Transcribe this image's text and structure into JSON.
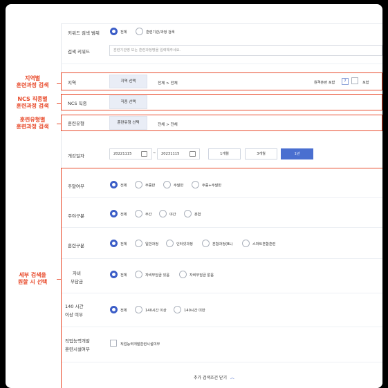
{
  "keyword_scope": {
    "label": "키워드 검색 범위",
    "options": [
      "전체",
      "훈련기관/과정 검색"
    ]
  },
  "keyword": {
    "label": "검색 키워드",
    "placeholder": "훈련기관명 또는 훈련과정명을 입력해주세요."
  },
  "region": {
    "label": "지역",
    "button": "지역 선택",
    "value": "전체 > 전체",
    "nearby_label": "원격훈련 포함",
    "help": "?",
    "include": "포함"
  },
  "ncs": {
    "label": "NCS 직종",
    "button": "직종 선택",
    "value": ""
  },
  "training_type": {
    "label": "훈련유형",
    "button": "훈련유형 선택",
    "value": "전체 > 전체"
  },
  "start_date": {
    "label": "개강일자",
    "from": "20221115",
    "tilde": "~",
    "to": "20231115",
    "periods": [
      "1개월",
      "3개월",
      "1년"
    ],
    "selected_period": "1년"
  },
  "weekend": {
    "label": "주말여부",
    "options": [
      "전체",
      "주중반",
      "주말반",
      "주중+주말반"
    ]
  },
  "daynight": {
    "label": "주야구분",
    "options": [
      "전체",
      "주간",
      "야간",
      "혼합"
    ]
  },
  "training_kind": {
    "label": "훈련구분",
    "options": [
      "전체",
      "일반과정",
      "인터넷과정",
      "혼합과정(BL)",
      "스마트혼합훈련"
    ]
  },
  "self_pay": {
    "label_line1": "자비",
    "label_line2": "부담금",
    "options": [
      "전체",
      "자비부담금 있음",
      "자비부담금 없음"
    ]
  },
  "hours140": {
    "label_line1": "140 시간",
    "label_line2": "이상 여부",
    "options": [
      "전체",
      "140시간 이상",
      "140시간 미만"
    ]
  },
  "facility": {
    "label_line1": "직업능력개발",
    "label_line2": "훈련시설여부",
    "checkbox_label": "직업능력개발훈련시설여부"
  },
  "collapse": {
    "label": "추가 검색조건 닫기"
  },
  "annotations": {
    "region_line1": "지역별",
    "region_line2": "훈련과정 검색",
    "ncs_line1": "NCS 직종별",
    "ncs_line2": "훈련과정 검색",
    "type_line1": "훈련유형별",
    "type_line2": "훈련과정 검색",
    "detail_line1": "세부 검색을",
    "detail_line2": "원할 시 선택"
  },
  "colors": {
    "accent": "#3b5dc7",
    "annotation": "#e8492a",
    "selected_period_bg": "#4a6fd0"
  }
}
